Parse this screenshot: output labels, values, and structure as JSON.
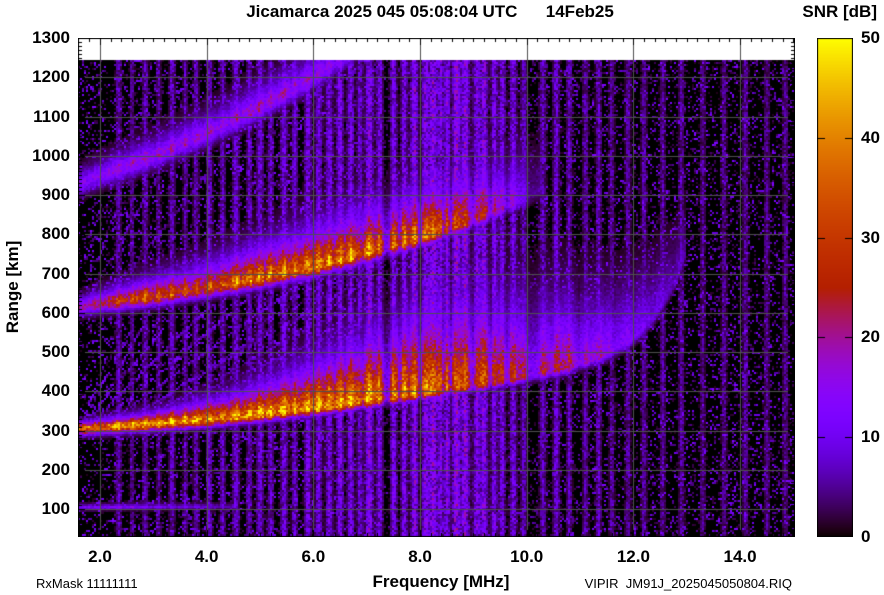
{
  "header": {
    "title": "Jicamarca 2025 045 05:08:04 UTC      14Feb25",
    "colorbar_title": "SNR [dB]"
  },
  "footer": {
    "rx_mask": "RxMask 11111111",
    "xlabel": "Frequency [MHz]",
    "file_label": "VIPIR  JM91J_2025045050804.RIQ"
  },
  "ylabel": "Range [km]",
  "chart_data": {
    "type": "heatmap",
    "title": "Jicamarca 2025 045 05:08:04 UTC      14Feb25",
    "xlabel": "Frequency [MHz]",
    "ylabel": "Range [km]",
    "zlabel": "SNR [dB]",
    "xlim": [
      1.5875,
      15.03
    ],
    "ylim": [
      29,
      1300
    ],
    "zlim": [
      0,
      50
    ],
    "x_ticks": [
      2,
      4,
      6,
      8,
      10,
      12,
      14
    ],
    "x_tick_labels": [
      "2.0",
      "4.0",
      "6.0",
      "8.0",
      "10.0",
      "12.0",
      "14.0"
    ],
    "x_minor_step": 0.2,
    "y_ticks": [
      100,
      200,
      300,
      400,
      500,
      600,
      700,
      800,
      900,
      1000,
      1100,
      1200,
      1300
    ],
    "y_minor_step": 10,
    "z_ticks": [
      0,
      10,
      20,
      30,
      40,
      50
    ],
    "grid": true,
    "grid_color": "#4f4f4f",
    "palette": "gnuplot-rgbformulae-7-5-15",
    "palette_stops": {
      "0": "#000000",
      "10": "#7202f2",
      "20": "#a11096",
      "30": "#c63700",
      "40": "#e48300",
      "50": "#ffff00"
    },
    "data_top_km": 1245,
    "background_speckle": {
      "density": 0.42,
      "max_db": 13
    },
    "echo_layers": [
      {
        "name": "first-hop-F-region-trace",
        "curve": [
          [
            1.59,
            306
          ],
          [
            2.0,
            310
          ],
          [
            3.0,
            318
          ],
          [
            4.0,
            328
          ],
          [
            5.0,
            341
          ],
          [
            6.0,
            357
          ],
          [
            7.0,
            376
          ],
          [
            8.0,
            396
          ],
          [
            9.0,
            417
          ],
          [
            10.0,
            440
          ],
          [
            10.8,
            464
          ],
          [
            11.5,
            495
          ],
          [
            12.0,
            535
          ],
          [
            12.4,
            590
          ],
          [
            12.8,
            680
          ],
          [
            13.0,
            760
          ]
        ],
        "peak_db": [
          [
            1.59,
            45
          ],
          [
            2.5,
            46
          ],
          [
            4.0,
            44
          ],
          [
            5.5,
            42
          ],
          [
            6.5,
            40
          ],
          [
            7.5,
            36
          ],
          [
            8.5,
            30
          ],
          [
            9.3,
            27
          ],
          [
            10.0,
            24
          ],
          [
            10.7,
            25
          ],
          [
            11.3,
            19
          ],
          [
            12.0,
            13
          ],
          [
            12.5,
            10
          ],
          [
            13.0,
            6
          ]
        ],
        "spread_up_km": [
          [
            1.59,
            12
          ],
          [
            3.0,
            22
          ],
          [
            4.5,
            45
          ],
          [
            6.0,
            85
          ],
          [
            7.0,
            125
          ],
          [
            8.0,
            165
          ],
          [
            9.0,
            185
          ],
          [
            10.0,
            160
          ],
          [
            10.8,
            140
          ],
          [
            11.5,
            130
          ],
          [
            12.3,
            120
          ],
          [
            13.0,
            100
          ]
        ],
        "spread_down_km": 12
      },
      {
        "name": "second-hop-echo",
        "curve": [
          [
            1.59,
            616
          ],
          [
            2.0,
            625
          ],
          [
            3.0,
            642
          ],
          [
            4.0,
            663
          ],
          [
            5.0,
            688
          ],
          [
            6.0,
            717
          ],
          [
            7.0,
            752
          ],
          [
            8.0,
            792
          ],
          [
            9.0,
            838
          ],
          [
            9.8,
            884
          ],
          [
            10.3,
            915
          ]
        ],
        "peak_db": [
          [
            1.59,
            22
          ],
          [
            2.2,
            30
          ],
          [
            3.0,
            34
          ],
          [
            3.8,
            30
          ],
          [
            4.5,
            37
          ],
          [
            5.5,
            38
          ],
          [
            6.5,
            37
          ],
          [
            7.5,
            34
          ],
          [
            8.3,
            30
          ],
          [
            9.0,
            24
          ],
          [
            9.8,
            14
          ],
          [
            10.3,
            7
          ]
        ],
        "spread_up_km": [
          [
            1.59,
            20
          ],
          [
            3.0,
            40
          ],
          [
            5.0,
            65
          ],
          [
            7.0,
            90
          ],
          [
            9.0,
            105
          ],
          [
            10.3,
            105
          ]
        ],
        "spread_down_km": 16
      },
      {
        "name": "third-hop-echo",
        "curve": [
          [
            1.59,
            930
          ],
          [
            2.0,
            952
          ],
          [
            3.0,
            1000
          ],
          [
            4.0,
            1058
          ],
          [
            5.0,
            1125
          ],
          [
            5.8,
            1185
          ],
          [
            6.5,
            1245
          ],
          [
            7.0,
            1290
          ]
        ],
        "peak_db": [
          [
            1.59,
            16
          ],
          [
            2.5,
            18
          ],
          [
            4.0,
            17
          ],
          [
            5.0,
            18
          ],
          [
            5.8,
            16
          ],
          [
            6.5,
            13
          ],
          [
            7.0,
            8
          ]
        ],
        "spread_up_km": [
          [
            1.59,
            30
          ],
          [
            3.0,
            40
          ],
          [
            5.0,
            50
          ],
          [
            7.0,
            55
          ]
        ],
        "spread_down_km": 22
      },
      {
        "name": "E-region-echo",
        "curve": [
          [
            1.59,
            104
          ],
          [
            4.6,
            107
          ]
        ],
        "peak_db": [
          [
            1.59,
            15
          ],
          [
            2.6,
            13
          ],
          [
            4.6,
            7
          ]
        ],
        "spread_up_km": [
          [
            1.59,
            8
          ],
          [
            4.6,
            8
          ]
        ],
        "spread_down_km": 5
      }
    ],
    "rfi_stripes": [
      [
        2.35,
        0.05,
        8
      ],
      [
        2.6,
        0.04,
        7
      ],
      [
        2.85,
        0.05,
        8
      ],
      [
        3.1,
        0.04,
        7
      ],
      [
        3.35,
        0.05,
        9
      ],
      [
        3.6,
        0.04,
        8
      ],
      [
        3.8,
        0.05,
        8
      ],
      [
        4.05,
        0.05,
        10
      ],
      [
        4.3,
        0.05,
        9
      ],
      [
        4.55,
        0.06,
        10
      ],
      [
        4.8,
        0.05,
        9
      ],
      [
        5.0,
        0.06,
        11
      ],
      [
        5.2,
        0.05,
        10
      ],
      [
        5.45,
        0.06,
        12
      ],
      [
        5.65,
        0.05,
        10
      ],
      [
        5.9,
        0.06,
        13
      ],
      [
        6.1,
        0.06,
        12
      ],
      [
        6.3,
        0.06,
        13
      ],
      [
        6.5,
        0.06,
        14
      ],
      [
        6.7,
        0.06,
        13
      ],
      [
        6.88,
        0.05,
        15
      ],
      [
        7.05,
        0.07,
        16
      ],
      [
        7.25,
        0.06,
        14
      ],
      [
        7.5,
        0.06,
        15
      ],
      [
        7.7,
        0.06,
        14
      ],
      [
        7.9,
        0.07,
        16
      ],
      [
        8.1,
        0.07,
        15
      ],
      [
        8.25,
        0.07,
        17
      ],
      [
        8.4,
        0.06,
        16
      ],
      [
        8.52,
        0.06,
        17
      ],
      [
        8.68,
        0.07,
        18
      ],
      [
        8.85,
        0.07,
        17
      ],
      [
        9.05,
        0.07,
        18
      ],
      [
        9.2,
        0.06,
        16
      ],
      [
        9.38,
        0.06,
        15
      ],
      [
        9.55,
        0.06,
        13
      ],
      [
        9.75,
        0.06,
        12
      ],
      [
        9.95,
        0.06,
        10
      ],
      [
        10.3,
        0.06,
        10
      ],
      [
        10.55,
        0.06,
        11
      ],
      [
        10.8,
        0.05,
        9
      ],
      [
        11.1,
        0.05,
        9
      ],
      [
        11.35,
        0.05,
        9
      ],
      [
        11.6,
        0.05,
        8
      ],
      [
        11.9,
        0.05,
        7
      ],
      [
        12.2,
        0.05,
        7
      ],
      [
        12.55,
        0.05,
        7
      ],
      [
        12.9,
        0.05,
        7
      ],
      [
        13.3,
        0.05,
        6
      ],
      [
        13.7,
        0.05,
        6
      ],
      [
        14.1,
        0.05,
        7
      ],
      [
        14.5,
        0.05,
        6
      ],
      [
        14.85,
        0.05,
        6
      ]
    ],
    "rfi_gaps": [
      [
        6.9,
        0.05,
        0.5
      ],
      [
        7.38,
        0.09,
        0.8
      ],
      [
        7.62,
        0.04,
        0.5
      ],
      [
        8.0,
        0.05,
        0.6
      ],
      [
        8.44,
        0.04,
        0.6
      ],
      [
        8.57,
        0.04,
        0.7
      ],
      [
        9.0,
        0.06,
        0.7
      ],
      [
        9.33,
        0.04,
        0.6
      ],
      [
        9.62,
        0.05,
        0.5
      ],
      [
        10.12,
        0.18,
        0.55
      ],
      [
        10.48,
        0.05,
        0.4
      ],
      [
        11.0,
        0.12,
        0.45
      ],
      [
        11.65,
        0.06,
        0.4
      ]
    ],
    "oblique_spurs": [
      [
        1.7,
        320,
        3.2,
        560,
        9
      ],
      [
        1.8,
        315,
        4.0,
        610,
        8
      ],
      [
        2.0,
        320,
        4.8,
        640,
        9
      ],
      [
        2.2,
        325,
        5.6,
        660,
        8
      ],
      [
        2.5,
        330,
        6.0,
        610,
        7
      ],
      [
        1.7,
        330,
        2.6,
        560,
        10
      ],
      [
        1.9,
        340,
        3.0,
        620,
        9
      ],
      [
        2.8,
        350,
        5.2,
        560,
        7
      ],
      [
        3.2,
        360,
        6.2,
        580,
        7
      ],
      [
        1.65,
        620,
        2.4,
        900,
        8
      ],
      [
        1.8,
        640,
        3.2,
        980,
        7
      ],
      [
        2.2,
        650,
        4.0,
        950,
        6
      ],
      [
        1.65,
        310,
        2.1,
        480,
        11
      ],
      [
        3.6,
        380,
        6.6,
        560,
        6
      ]
    ]
  }
}
